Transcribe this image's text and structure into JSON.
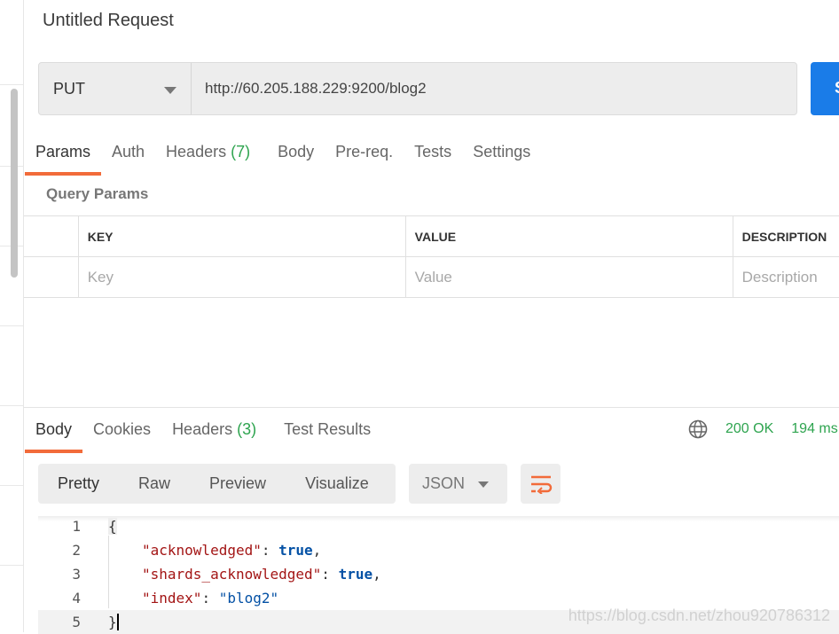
{
  "request": {
    "title": "Untitled Request",
    "method": "PUT",
    "url": "http://60.205.188.229:9200/blog2",
    "send_label": "S"
  },
  "request_tabs": [
    {
      "label": "Params",
      "active": true
    },
    {
      "label": "Auth"
    },
    {
      "label": "Headers",
      "count": "(7)"
    },
    {
      "label": "Body"
    },
    {
      "label": "Pre-req."
    },
    {
      "label": "Tests"
    },
    {
      "label": "Settings"
    }
  ],
  "params": {
    "title": "Query Params",
    "headers": [
      "KEY",
      "VALUE",
      "DESCRIPTION"
    ],
    "placeholders": [
      "Key",
      "Value",
      "Description"
    ]
  },
  "response_tabs": [
    {
      "label": "Body",
      "active": true
    },
    {
      "label": "Cookies"
    },
    {
      "label": "Headers",
      "count": "(3)"
    },
    {
      "label": "Test Results"
    }
  ],
  "response_status": {
    "status": "200 OK",
    "time": "194 ms",
    "icon": "globe-icon"
  },
  "view_modes": [
    "Pretty",
    "Raw",
    "Preview",
    "Visualize"
  ],
  "format": "JSON",
  "code_lines": [
    {
      "n": "1",
      "text": "{"
    },
    {
      "n": "2",
      "key": "\"acknowledged\"",
      "value": "true"
    },
    {
      "n": "3",
      "key": "\"shards_acknowledged\"",
      "value": "true"
    },
    {
      "n": "4",
      "key": "\"index\"",
      "value": "\"blog2\""
    },
    {
      "n": "5",
      "text": "}"
    }
  ],
  "watermark": "https://blog.csdn.net/zhou920786312",
  "colors": {
    "accent": "#f26b3a",
    "success": "#2ea44f",
    "send": "#1a7ce8"
  }
}
